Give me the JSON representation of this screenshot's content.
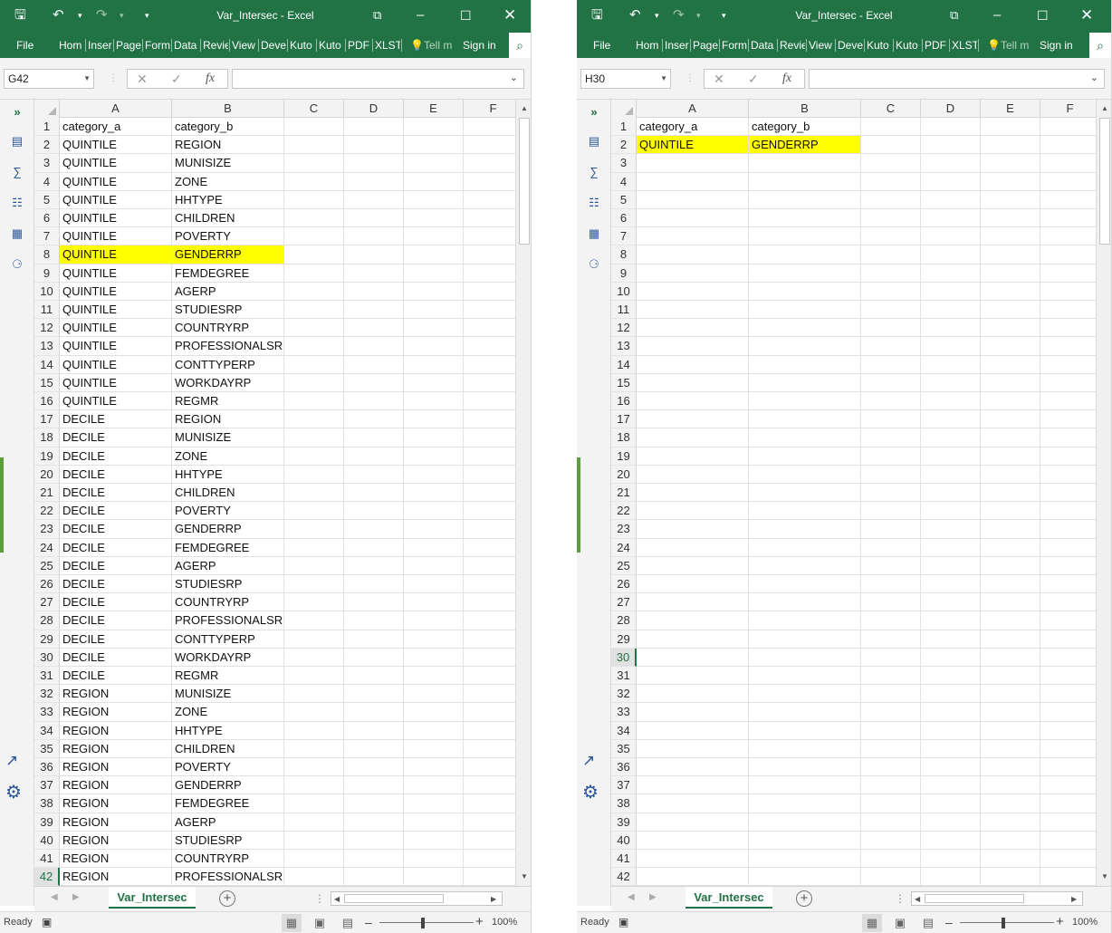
{
  "left": {
    "window_title": "Var_Intersec - Excel",
    "name_box": "G42",
    "selected_row": "42",
    "column_headers": [
      "A",
      "B",
      "C",
      "D",
      "E",
      "F"
    ],
    "highlight_row": "8",
    "rows": [
      {
        "num": "1",
        "a": "category_a",
        "b": "category_b"
      },
      {
        "num": "2",
        "a": "QUINTILE",
        "b": "REGION"
      },
      {
        "num": "3",
        "a": "QUINTILE",
        "b": "MUNISIZE"
      },
      {
        "num": "4",
        "a": "QUINTILE",
        "b": "ZONE"
      },
      {
        "num": "5",
        "a": "QUINTILE",
        "b": "HHTYPE"
      },
      {
        "num": "6",
        "a": "QUINTILE",
        "b": "CHILDREN"
      },
      {
        "num": "7",
        "a": "QUINTILE",
        "b": "POVERTY"
      },
      {
        "num": "8",
        "a": "QUINTILE",
        "b": "GENDERRP"
      },
      {
        "num": "9",
        "a": "QUINTILE",
        "b": "FEMDEGREE"
      },
      {
        "num": "10",
        "a": "QUINTILE",
        "b": "AGERP"
      },
      {
        "num": "11",
        "a": "QUINTILE",
        "b": "STUDIESRP"
      },
      {
        "num": "12",
        "a": "QUINTILE",
        "b": "COUNTRYRP"
      },
      {
        "num": "13",
        "a": "QUINTILE",
        "b": "PROFESSIONALSRP"
      },
      {
        "num": "14",
        "a": "QUINTILE",
        "b": "CONTTYPERP"
      },
      {
        "num": "15",
        "a": "QUINTILE",
        "b": "WORKDAYRP"
      },
      {
        "num": "16",
        "a": "QUINTILE",
        "b": "REGMR"
      },
      {
        "num": "17",
        "a": "DECILE",
        "b": "REGION"
      },
      {
        "num": "18",
        "a": "DECILE",
        "b": "MUNISIZE"
      },
      {
        "num": "19",
        "a": "DECILE",
        "b": "ZONE"
      },
      {
        "num": "20",
        "a": "DECILE",
        "b": "HHTYPE"
      },
      {
        "num": "21",
        "a": "DECILE",
        "b": "CHILDREN"
      },
      {
        "num": "22",
        "a": "DECILE",
        "b": "POVERTY"
      },
      {
        "num": "23",
        "a": "DECILE",
        "b": "GENDERRP"
      },
      {
        "num": "24",
        "a": "DECILE",
        "b": "FEMDEGREE"
      },
      {
        "num": "25",
        "a": "DECILE",
        "b": "AGERP"
      },
      {
        "num": "26",
        "a": "DECILE",
        "b": "STUDIESRP"
      },
      {
        "num": "27",
        "a": "DECILE",
        "b": "COUNTRYRP"
      },
      {
        "num": "28",
        "a": "DECILE",
        "b": "PROFESSIONALSRP"
      },
      {
        "num": "29",
        "a": "DECILE",
        "b": "CONTTYPERP"
      },
      {
        "num": "30",
        "a": "DECILE",
        "b": "WORKDAYRP"
      },
      {
        "num": "31",
        "a": "DECILE",
        "b": "REGMR"
      },
      {
        "num": "32",
        "a": "REGION",
        "b": "MUNISIZE"
      },
      {
        "num": "33",
        "a": "REGION",
        "b": "ZONE"
      },
      {
        "num": "34",
        "a": "REGION",
        "b": "HHTYPE"
      },
      {
        "num": "35",
        "a": "REGION",
        "b": "CHILDREN"
      },
      {
        "num": "36",
        "a": "REGION",
        "b": "POVERTY"
      },
      {
        "num": "37",
        "a": "REGION",
        "b": "GENDERRP"
      },
      {
        "num": "38",
        "a": "REGION",
        "b": "FEMDEGREE"
      },
      {
        "num": "39",
        "a": "REGION",
        "b": "AGERP"
      },
      {
        "num": "40",
        "a": "REGION",
        "b": "STUDIESRP"
      },
      {
        "num": "41",
        "a": "REGION",
        "b": "COUNTRYRP"
      },
      {
        "num": "42",
        "a": "REGION",
        "b": "PROFESSIONALSRP"
      }
    ]
  },
  "right": {
    "window_title": "Var_Intersec - Excel",
    "name_box": "H30",
    "selected_row": "30",
    "column_headers": [
      "A",
      "B",
      "C",
      "D",
      "E",
      "F"
    ],
    "highlight_row": "2",
    "rows": [
      {
        "num": "1",
        "a": "category_a",
        "b": "category_b"
      },
      {
        "num": "2",
        "a": "QUINTILE",
        "b": "GENDERRP"
      },
      {
        "num": "3",
        "a": "",
        "b": ""
      },
      {
        "num": "4",
        "a": "",
        "b": ""
      },
      {
        "num": "5",
        "a": "",
        "b": ""
      },
      {
        "num": "6",
        "a": "",
        "b": ""
      },
      {
        "num": "7",
        "a": "",
        "b": ""
      },
      {
        "num": "8",
        "a": "",
        "b": ""
      },
      {
        "num": "9",
        "a": "",
        "b": ""
      },
      {
        "num": "10",
        "a": "",
        "b": ""
      },
      {
        "num": "11",
        "a": "",
        "b": ""
      },
      {
        "num": "12",
        "a": "",
        "b": ""
      },
      {
        "num": "13",
        "a": "",
        "b": ""
      },
      {
        "num": "14",
        "a": "",
        "b": ""
      },
      {
        "num": "15",
        "a": "",
        "b": ""
      },
      {
        "num": "16",
        "a": "",
        "b": ""
      },
      {
        "num": "17",
        "a": "",
        "b": ""
      },
      {
        "num": "18",
        "a": "",
        "b": ""
      },
      {
        "num": "19",
        "a": "",
        "b": ""
      },
      {
        "num": "20",
        "a": "",
        "b": ""
      },
      {
        "num": "21",
        "a": "",
        "b": ""
      },
      {
        "num": "22",
        "a": "",
        "b": ""
      },
      {
        "num": "23",
        "a": "",
        "b": ""
      },
      {
        "num": "24",
        "a": "",
        "b": ""
      },
      {
        "num": "25",
        "a": "",
        "b": ""
      },
      {
        "num": "26",
        "a": "",
        "b": ""
      },
      {
        "num": "27",
        "a": "",
        "b": ""
      },
      {
        "num": "28",
        "a": "",
        "b": ""
      },
      {
        "num": "29",
        "a": "",
        "b": ""
      },
      {
        "num": "30",
        "a": "",
        "b": ""
      },
      {
        "num": "31",
        "a": "",
        "b": ""
      },
      {
        "num": "32",
        "a": "",
        "b": ""
      },
      {
        "num": "33",
        "a": "",
        "b": ""
      },
      {
        "num": "34",
        "a": "",
        "b": ""
      },
      {
        "num": "35",
        "a": "",
        "b": ""
      },
      {
        "num": "36",
        "a": "",
        "b": ""
      },
      {
        "num": "37",
        "a": "",
        "b": ""
      },
      {
        "num": "38",
        "a": "",
        "b": ""
      },
      {
        "num": "39",
        "a": "",
        "b": ""
      },
      {
        "num": "40",
        "a": "",
        "b": ""
      },
      {
        "num": "41",
        "a": "",
        "b": ""
      },
      {
        "num": "42",
        "a": "",
        "b": ""
      }
    ]
  },
  "ribbon": {
    "file": "File",
    "tabs": [
      "Hom",
      "Inser",
      "Page",
      "Form",
      "Data",
      "Revie",
      "View",
      "Deve",
      "Kuto",
      "Kuto",
      "PDF",
      "XLST"
    ],
    "tell_me": "Tell m",
    "sign_in": "Sign in"
  },
  "sheet_tab": "Var_Intersec",
  "status": {
    "ready": "Ready",
    "zoom": "100%"
  },
  "icons": {
    "save": "save-icon",
    "undo": "undo-icon",
    "redo": "redo-icon",
    "customize": "customize-qat-icon",
    "ribbon_display": "ribbon-display-options-icon",
    "minimize": "minimize-icon",
    "maximize": "maximize-icon",
    "close": "close-icon",
    "search": "search-icon",
    "cancel": "cancel-icon",
    "enter": "enter-icon",
    "function": "insert-function-icon"
  },
  "colors": {
    "excel_green": "#217346",
    "highlight": "#ffff00"
  }
}
